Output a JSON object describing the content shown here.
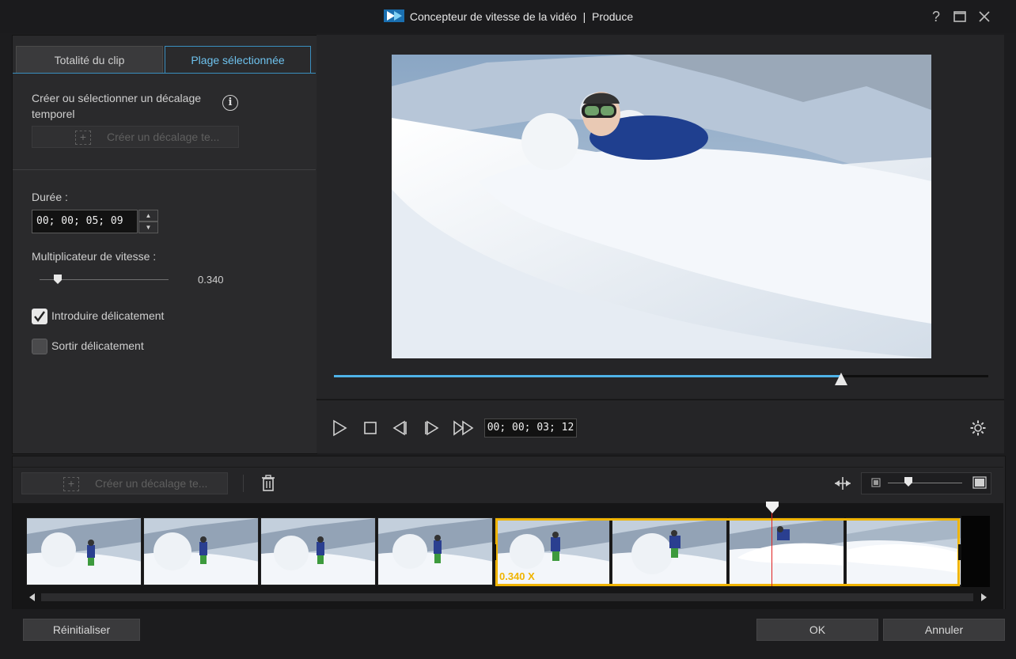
{
  "window": {
    "title_app": "Concepteur de vitesse de la vidéo",
    "title_separator": "|",
    "title_mode": "Produce",
    "help_label": "?",
    "close_label": "✕"
  },
  "tabs": [
    {
      "label": "Totalité du clip",
      "active": false
    },
    {
      "label": "Plage sélectionnée",
      "active": true
    }
  ],
  "left": {
    "offset_heading": "Créer ou sélectionner un décalage temporel",
    "info_label": "i",
    "create_offset_label": "Créer un décalage te...",
    "duration_label": "Durée :",
    "duration_value": "00; 00; 05; 09",
    "speed_label": "Multiplicateur de vitesse :",
    "speed_value": "0.340",
    "speed_fraction": 0.14,
    "ease_in_label": "Introduire délicatement",
    "ease_in_checked": true,
    "ease_out_label": "Sortir délicatement",
    "ease_out_checked": false
  },
  "player": {
    "position_fraction": 0.775,
    "timecode": "00; 00; 03; 12"
  },
  "timeline": {
    "create_offset_label": "Créer un décalage te...",
    "selection_speed_label": "0.340 X",
    "zoom_fraction": 0.28
  },
  "footer": {
    "reset_label": "Réinitialiser",
    "ok_label": "OK",
    "cancel_label": "Annuler"
  },
  "colors": {
    "accent_blue": "#4fb3e8",
    "selection_yellow": "#f0b400",
    "playhead_red": "#e02020"
  }
}
